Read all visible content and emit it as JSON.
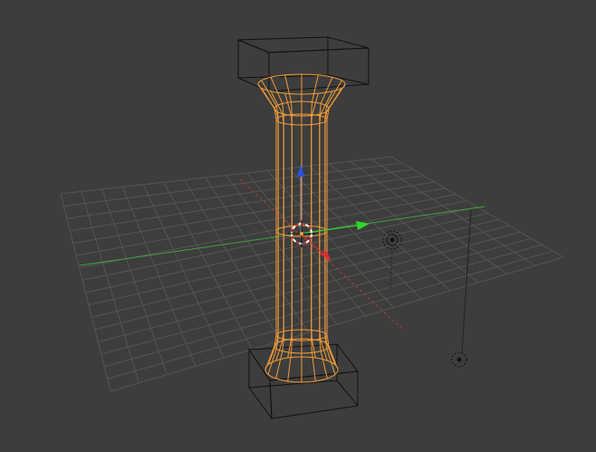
{
  "viewport": {
    "mode": "wireframe",
    "background_color": "#3d3d3d",
    "grid_color": "#555555",
    "x_axis_color": "#b83a3a",
    "y_axis_color": "#3fa33f",
    "selection_color": "#f29c38",
    "unselected_wire_color": "#111111"
  },
  "objects": [
    {
      "name": "column-shaft",
      "selected": true
    },
    {
      "name": "capital-box",
      "selected": false
    },
    {
      "name": "base-box",
      "selected": false
    },
    {
      "name": "lamp",
      "selected": false
    },
    {
      "name": "camera-target",
      "selected": false
    }
  ],
  "manipulator": {
    "type": "translate",
    "x_color": "#d93030",
    "y_color": "#2fd62f",
    "z_color": "#2f4fe0"
  },
  "icons": {
    "cursor": "3d-cursor-icon",
    "lamp": "lamp-icon",
    "empty": "empty-icon"
  }
}
